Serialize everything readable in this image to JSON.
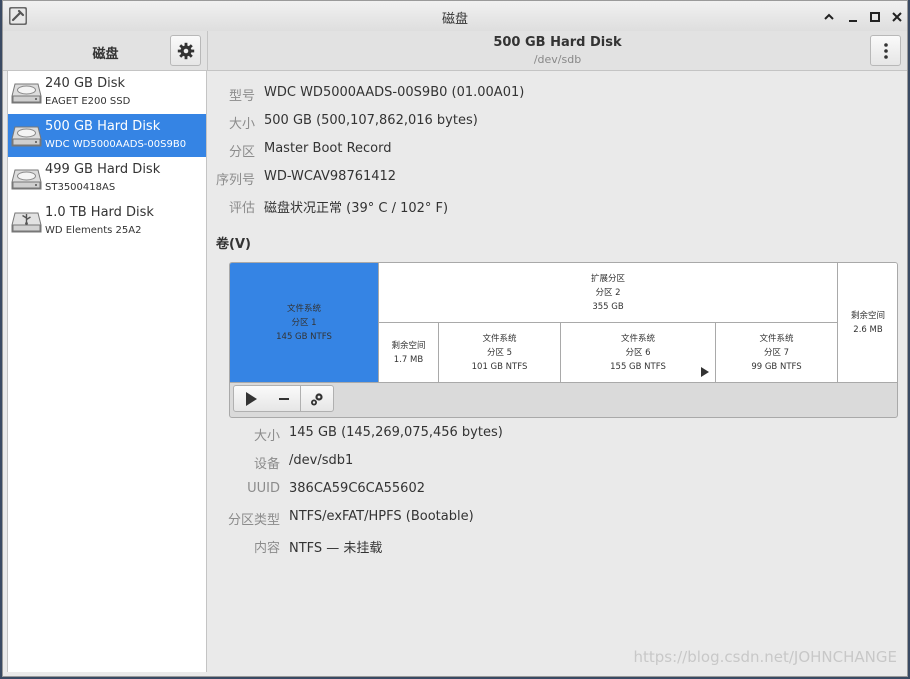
{
  "window": {
    "title": "磁盘"
  },
  "sidebar": {
    "header_label": "磁盘",
    "disks": [
      {
        "name": "240 GB Disk",
        "model": "EAGET E200 SSD",
        "icon": "hard-disk-icon",
        "selected": false
      },
      {
        "name": "500 GB Hard Disk",
        "model": "WDC WD5000AADS-00S9B0",
        "icon": "hard-disk-icon",
        "selected": true
      },
      {
        "name": "499 GB Hard Disk",
        "model": "ST3500418AS",
        "icon": "hard-disk-icon",
        "selected": false
      },
      {
        "name": "1.0 TB Hard Disk",
        "model": "WD Elements 25A2",
        "icon": "usb-drive-icon",
        "selected": false
      }
    ]
  },
  "header": {
    "title": "500 GB Hard Disk",
    "subtitle": "/dev/sdb"
  },
  "drive_info": [
    {
      "key": "型号",
      "value": "WDC WD5000AADS-00S9B0 (01.00A01)"
    },
    {
      "key": "大小",
      "value": "500 GB (500,107,862,016 bytes)"
    },
    {
      "key": "分区",
      "value": "Master Boot Record"
    },
    {
      "key": "序列号",
      "value": "WD-WCAV98761412"
    },
    {
      "key": "评估",
      "value": "磁盘状况正常 (39° C / 102° F)"
    }
  ],
  "volumes_label": "卷(V)",
  "volumes": {
    "p1": {
      "l1": "文件系统",
      "l2": "分区 1",
      "l3": "145 GB NTFS"
    },
    "ext": {
      "l1": "扩展分区",
      "l2": "分区 2",
      "l3": "355 GB"
    },
    "free1": {
      "l1": "剩余空间",
      "l2": "1.7 MB"
    },
    "p5": {
      "l1": "文件系统",
      "l2": "分区 5",
      "l3": "101 GB NTFS"
    },
    "p6": {
      "l1": "文件系统",
      "l2": "分区 6",
      "l3": "155 GB NTFS"
    },
    "p7": {
      "l1": "文件系统",
      "l2": "分区 7",
      "l3": "99 GB NTFS"
    },
    "free2": {
      "l1": "剩余空间",
      "l2": "2.6 MB"
    }
  },
  "partition_info": [
    {
      "key": "大小",
      "value": "145 GB (145,269,075,456 bytes)"
    },
    {
      "key": "设备",
      "value": "/dev/sdb1"
    },
    {
      "key": "UUID",
      "value": "386CA59C6CA55602"
    },
    {
      "key": "分区类型",
      "value": "NTFS/exFAT/HPFS (Bootable)"
    },
    {
      "key": "内容",
      "value": "NTFS — 未挂载"
    }
  ],
  "watermark": "https://blog.csdn.net/JOHNCHANGE",
  "colors": {
    "selection": "#3584e4"
  }
}
